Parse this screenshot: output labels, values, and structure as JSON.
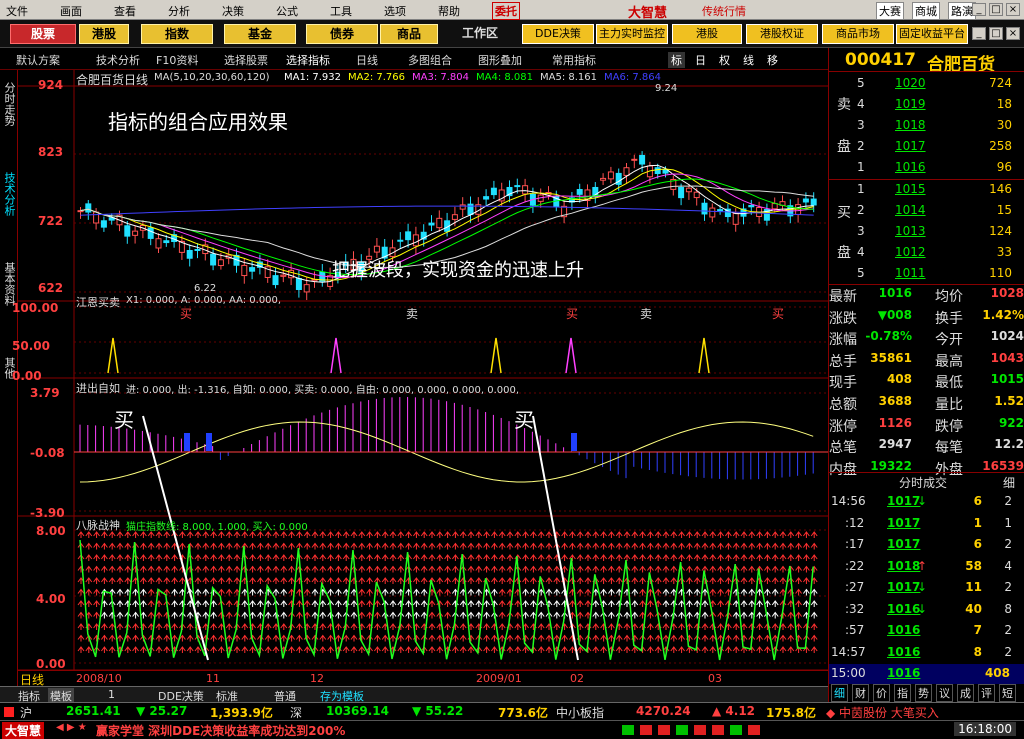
{
  "menu": [
    "文件",
    "画面",
    "查看",
    "分析",
    "决策",
    "公式",
    "工具",
    "选项",
    "帮助"
  ],
  "menubar_right": {
    "trade": "委托",
    "logo": "大智慧",
    "logo_sub": "传统行情",
    "links": [
      "大赛",
      "商城",
      "路演"
    ]
  },
  "toolbar_left": [
    "股票",
    "港股",
    "指数",
    "基金",
    "债券",
    "商品"
  ],
  "toolbar_workarea": "工作区",
  "toolbar_right": [
    "DDE决策",
    "主力实时监控",
    "港股",
    "港股权证",
    "商品市场",
    "固定收益平台"
  ],
  "subtool": [
    "默认方案",
    "技术分析",
    "F10资料",
    "选择股票",
    "选择指标",
    "日线",
    "多图组合",
    "图形叠加",
    "常用指标"
  ],
  "subtool_icons": [
    "标",
    "日",
    "权",
    "线",
    "移"
  ],
  "lefttabs": [
    "分时走势",
    "技术分析",
    "基本资料",
    "其他"
  ],
  "main": {
    "title_stock": "合肥百货",
    "title_period": "日线",
    "ma_text": "MA(5,10,20,30,60,120)",
    "ma_items": [
      {
        "label": "MA1: 7.932",
        "color": "#ffffff"
      },
      {
        "label": "MA2: 7.766",
        "color": "#ffff00"
      },
      {
        "label": "MA3: 7.804",
        "color": "#ff40ff"
      },
      {
        "label": "MA4: 8.081",
        "color": "#00ff00"
      },
      {
        "label": "MA5: 8.161",
        "color": "#dddddd"
      },
      {
        "label": "MA6: 7.864",
        "color": "#4040ff"
      }
    ],
    "axis": [
      "924",
      "823",
      "722",
      "622"
    ],
    "high_label": "9.24",
    "low_label": "6.22",
    "caption1": "指标的组合应用效果",
    "caption2": "把握波段，实现资金的迅速上升"
  },
  "ind1": {
    "title": "江恩买卖",
    "vals": "X1: 0.000, A: 0.000, AA: 0.000,",
    "axis": [
      "100.00",
      "50.00",
      "0.00"
    ],
    "signals": [
      "买",
      "卖",
      "买",
      "卖",
      "买"
    ]
  },
  "ind2": {
    "title": "进出自如",
    "vals": "进: 0.000, 出: -1.316, 自如: 0.000, 买卖: 0.000, 自由: 0.000, 0.000, 0.000, 0.000,",
    "axis": [
      "3.79",
      "-0.08",
      "-3.90"
    ],
    "buy": "买"
  },
  "ind3": {
    "title": "八脉战神",
    "vals": "猫庄指数线: 8.000, 1.000, 买入: 0.000",
    "axis": [
      "8.00",
      "4.00",
      "0.00"
    ]
  },
  "bottom_axis": {
    "label": "日线",
    "dates": [
      "2008/10",
      "11",
      "12",
      "2009/01",
      "02",
      "03"
    ]
  },
  "bottom_tabs": [
    "指标",
    "模板",
    "1",
    "DDE决策",
    "标准",
    "普通",
    "存为模板"
  ],
  "status1": {
    "sh_label": "沪",
    "sh": "2651.41",
    "sh_chg": "▼ 25.27",
    "sh_vol": "1,393.9亿",
    "sz_label": "深",
    "sz": "10369.14",
    "sz_chg": "▼ 55.22",
    "sz_vol": "773.6亿",
    "sme": "中小板指",
    "sme_val": "4270.24",
    "sme_chg": "▲ 4.12",
    "sme_vol": "175.8亿",
    "news": "◆ 中茵股份 大笔买入"
  },
  "status2": {
    "logo": "大智慧",
    "ticker": "赢家学堂 深圳DDE决策收益率成功达到200%",
    "time": "16:18:00"
  },
  "panel": {
    "code": "000417",
    "name": "合肥百货",
    "sell_label": [
      "卖",
      "盘"
    ],
    "buy_label": [
      "买",
      "盘"
    ],
    "sells": [
      {
        "n": "5",
        "p": "1020",
        "v": "724"
      },
      {
        "n": "4",
        "p": "1019",
        "v": "18"
      },
      {
        "n": "3",
        "p": "1018",
        "v": "30"
      },
      {
        "n": "2",
        "p": "1017",
        "v": "258"
      },
      {
        "n": "1",
        "p": "1016",
        "v": "96"
      }
    ],
    "buys": [
      {
        "n": "1",
        "p": "1015",
        "v": "146"
      },
      {
        "n": "2",
        "p": "1014",
        "v": "15"
      },
      {
        "n": "3",
        "p": "1013",
        "v": "124"
      },
      {
        "n": "4",
        "p": "1012",
        "v": "33"
      },
      {
        "n": "5",
        "p": "1011",
        "v": "110"
      }
    ],
    "stats": [
      {
        "l1": "最新",
        "v1": "1016",
        "c1": "#00e600",
        "l2": "均价",
        "v2": "1028",
        "c2": "#ff4040"
      },
      {
        "l1": "涨跌",
        "v1": "▼008",
        "c1": "#00e600",
        "l2": "换手",
        "v2": "1.42%",
        "c2": "#ffd000"
      },
      {
        "l1": "涨幅",
        "v1": "-0.78%",
        "c1": "#00e600",
        "l2": "今开",
        "v2": "1024",
        "c2": "#dddddd"
      },
      {
        "l1": "总手",
        "v1": "35861",
        "c1": "#ffd000",
        "l2": "最高",
        "v2": "1043",
        "c2": "#ff4040"
      },
      {
        "l1": "现手",
        "v1": "408",
        "c1": "#ffd000",
        "l2": "最低",
        "v2": "1015",
        "c2": "#00e600"
      },
      {
        "l1": "总额",
        "v1": "3688",
        "c1": "#ffd000",
        "l2": "量比",
        "v2": "1.52",
        "c2": "#ffd000"
      },
      {
        "l1": "涨停",
        "v1": "1126",
        "c1": "#ff4040",
        "l2": "跌停",
        "v2": "922",
        "c2": "#00e600"
      },
      {
        "l1": "总笔",
        "v1": "2947",
        "c1": "#dddddd",
        "l2": "每笔",
        "v2": "12.2",
        "c2": "#dddddd"
      },
      {
        "l1": "内盘",
        "v1": "19322",
        "c1": "#00e600",
        "l2": "外盘",
        "v2": "16539",
        "c2": "#ff4040"
      }
    ],
    "ticks_title": "分时成交",
    "ticks_btn": "细",
    "ticks": [
      {
        "t": "14:56",
        "p": "1017",
        "a": "↓",
        "v": "6",
        "n": "2"
      },
      {
        "t": ":12",
        "p": "1017",
        "a": "",
        "v": "1",
        "n": "1"
      },
      {
        "t": ":17",
        "p": "1017",
        "a": "",
        "v": "6",
        "n": "2"
      },
      {
        "t": ":22",
        "p": "1018",
        "a": "↑",
        "v": "58",
        "n": "4"
      },
      {
        "t": ":27",
        "p": "1017",
        "a": "↓",
        "v": "11",
        "n": "2"
      },
      {
        "t": ":32",
        "p": "1016",
        "a": "↓",
        "v": "40",
        "n": "8"
      },
      {
        "t": ":57",
        "p": "1016",
        "a": "",
        "v": "7",
        "n": "2"
      },
      {
        "t": "14:57",
        "p": "1016",
        "a": "",
        "v": "8",
        "n": "2"
      },
      {
        "t": "15:00",
        "p": "1016",
        "a": "",
        "v": "408",
        "n": ""
      }
    ],
    "bottom_tabs": [
      "细",
      "财",
      "价",
      "指",
      "势",
      "议",
      "成",
      "评",
      "短"
    ]
  }
}
